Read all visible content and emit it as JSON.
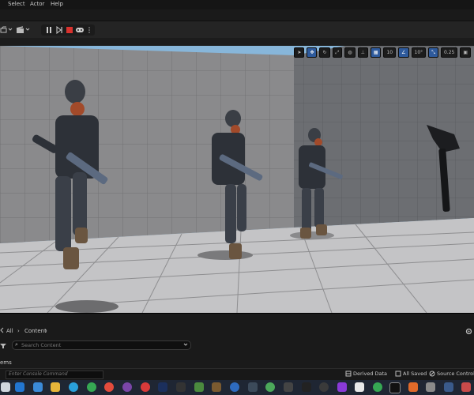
{
  "menu": {
    "items": [
      "Select",
      "Actor",
      "Help"
    ]
  },
  "viewport_toolbar": {
    "grid_snap": "10",
    "rotation_snap": "10°",
    "scale_snap": "0.25"
  },
  "content_browser": {
    "breadcrumb_all": "All",
    "breadcrumb_content": "Content",
    "search_placeholder": "Search Content",
    "items_label": "ems"
  },
  "status_bar": {
    "console_placeholder": "Enter Console Command",
    "derived_data": "Derived Data",
    "all_saved": "All Saved",
    "source_control": "Source Control"
  },
  "colors": {
    "sky": "#87b6da",
    "accent_blue": "#2e5a9c",
    "play_stop": "#d9322e",
    "taskbar": "#1f2633"
  },
  "taskbar_icons": [
    "start-icon",
    "search-icon",
    "edge-icon",
    "files-icon",
    "telegram-icon",
    "chrome-icon",
    "photoshop-icon",
    "terminal-icon",
    "minecraft-icon",
    "epic-games-icon",
    "unreal-engine-icon"
  ]
}
